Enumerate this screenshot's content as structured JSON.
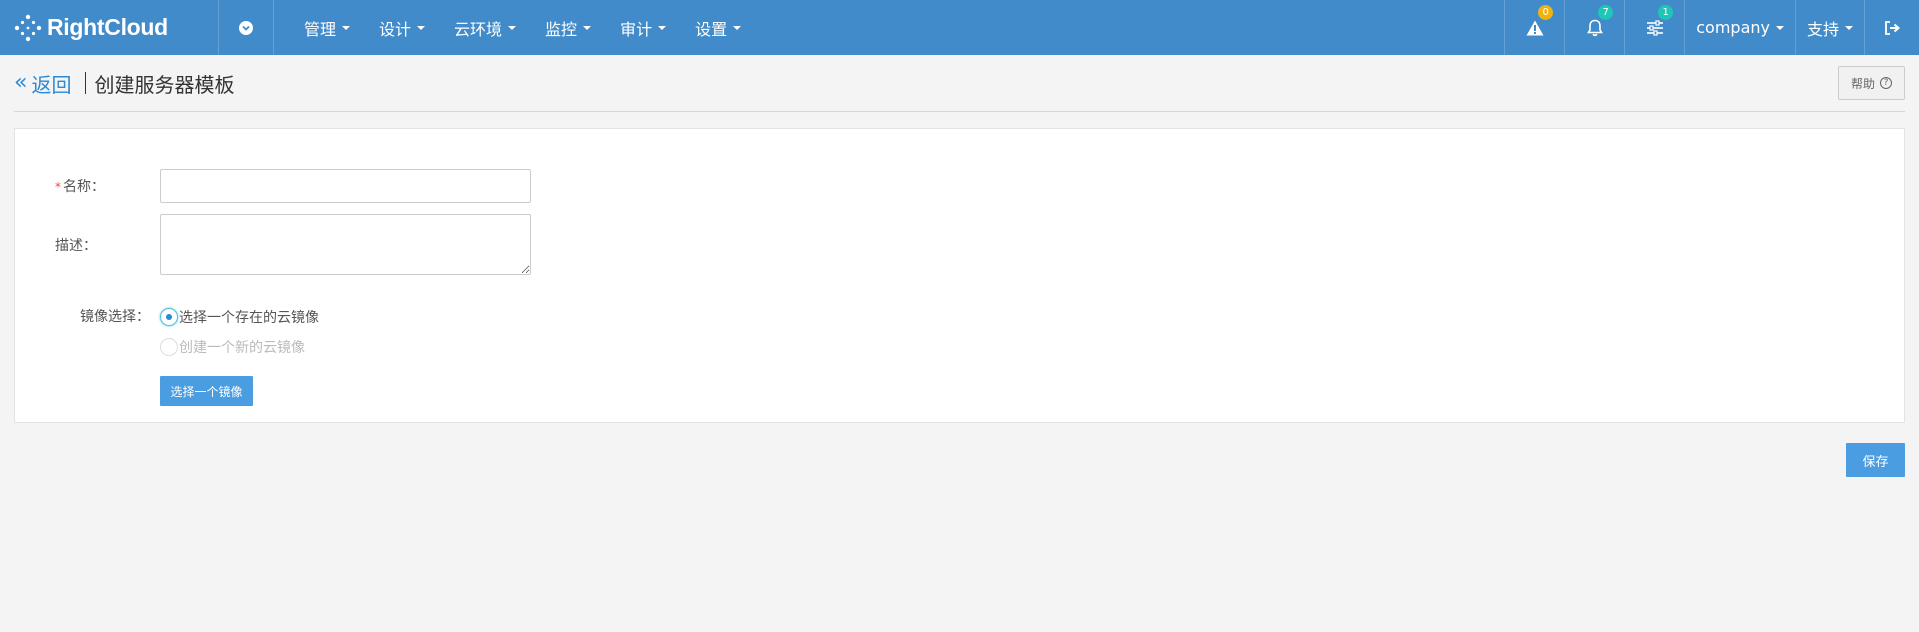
{
  "navbar": {
    "brand": "RightCloud",
    "menu": [
      {
        "label": "管理"
      },
      {
        "label": "设计"
      },
      {
        "label": "云环境"
      },
      {
        "label": "监控"
      },
      {
        "label": "审计"
      },
      {
        "label": "设置"
      }
    ],
    "alerts_count": "0",
    "notifications_count": "7",
    "tasks_count": "1",
    "company_label": "company",
    "support_label": "支持",
    "colors": {
      "bar": "#428bca",
      "badge_yellow": "#f0b20f",
      "badge_teal": "#1ec6b6"
    }
  },
  "header": {
    "back_label": "返回",
    "title": "创建服务器模板",
    "help_label": "帮助"
  },
  "form": {
    "name_label": "名称：",
    "name_value": "",
    "description_label": "描述：",
    "description_value": "",
    "image_choice_label": "镜像选择：",
    "options": [
      {
        "label": "选择一个存在的云镜像",
        "checked": true,
        "disabled": false
      },
      {
        "label": "创建一个新的云镜像",
        "checked": false,
        "disabled": true
      }
    ],
    "select_image_button": "选择一个镜像"
  },
  "footer": {
    "save_label": "保存"
  }
}
